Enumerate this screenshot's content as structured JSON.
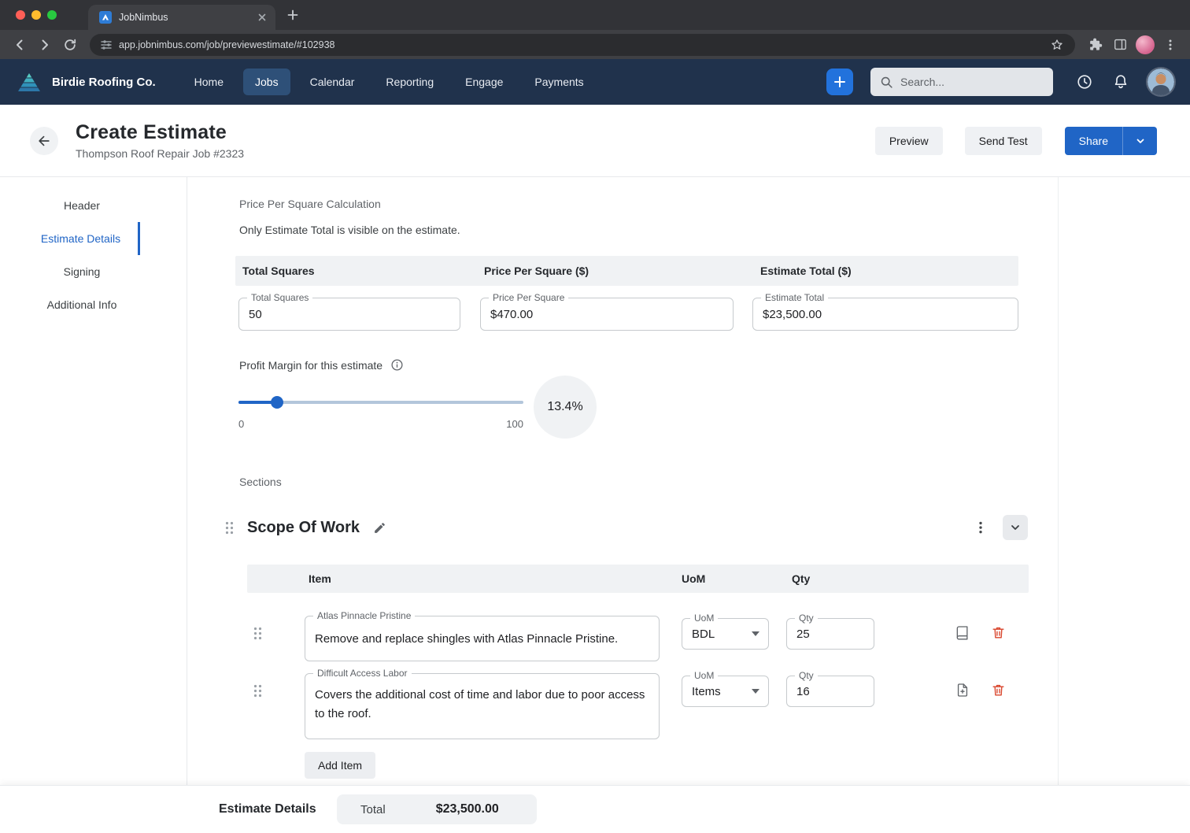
{
  "browser": {
    "tab_title": "JobNimbus",
    "url": "app.jobnimbus.com/job/previewestimate/#102938"
  },
  "app_header": {
    "company": "Birdie Roofing Co.",
    "nav": [
      {
        "label": "Home"
      },
      {
        "label": "Jobs"
      },
      {
        "label": "Calendar"
      },
      {
        "label": "Reporting"
      },
      {
        "label": "Engage"
      },
      {
        "label": "Payments"
      }
    ],
    "search_placeholder": "Search..."
  },
  "page_header": {
    "title": "Create Estimate",
    "subtitle": "Thompson Roof Repair Job #2323",
    "buttons": {
      "preview": "Preview",
      "send_test": "Send Test",
      "share": "Share"
    }
  },
  "sidebar": {
    "items": [
      {
        "label": "Header"
      },
      {
        "label": "Estimate Details"
      },
      {
        "label": "Signing"
      },
      {
        "label": "Additional Info"
      }
    ]
  },
  "calc": {
    "heading": "Price Per Square Calculation",
    "note": "Only Estimate Total is visible on the estimate.",
    "columns": [
      "Total Squares",
      "Price Per Square ($)",
      "Estimate Total ($)"
    ],
    "fields": [
      {
        "label": "Total Squares",
        "value": "50"
      },
      {
        "label": "Price Per Square",
        "value": "$470.00"
      },
      {
        "label": "Estimate Total",
        "value": "$23,500.00"
      }
    ]
  },
  "profit_margin": {
    "label": "Profit Margin for this estimate",
    "min": "0",
    "max": "100",
    "value_pct": "13.4",
    "value_label": "13.4%"
  },
  "sections": {
    "heading": "Sections",
    "title": "Scope Of Work",
    "columns": [
      "Item",
      "UoM",
      "Qty"
    ],
    "uom_label": "UoM",
    "qty_label": "Qty",
    "items": [
      {
        "label": "Atlas Pinnacle Pristine",
        "description": "Remove and replace shingles with Atlas Pinnacle Pristine.",
        "uom": "BDL",
        "qty": "25"
      },
      {
        "label": "Difficult Access Labor",
        "description": "Covers the additional cost of time and labor due to poor access to the roof.",
        "uom": "Items",
        "qty": "16"
      }
    ],
    "add_item": "Add Item"
  },
  "footer": {
    "title": "Estimate Details",
    "total_label": "Total",
    "total_value": "$23,500.00"
  },
  "colors": {
    "accent": "#2065C6",
    "app_header_bg": "#20324C",
    "danger": "#D9442B"
  }
}
